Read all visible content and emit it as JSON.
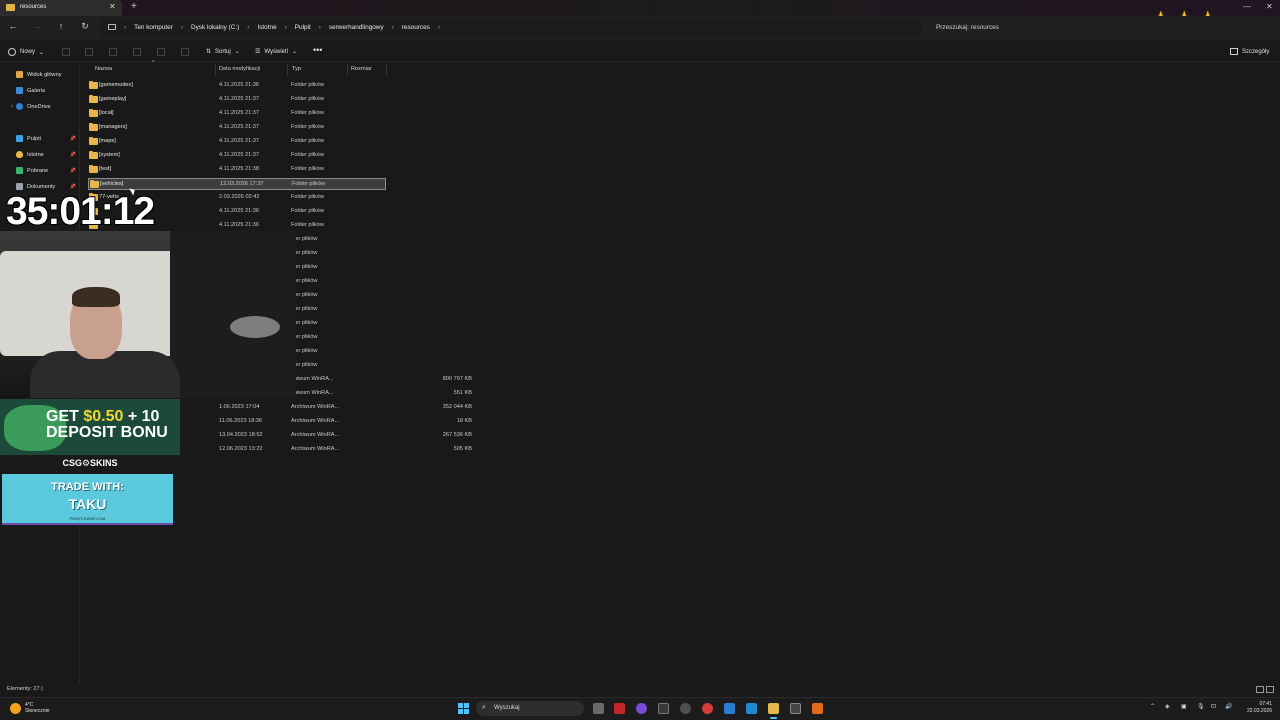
{
  "window": {
    "tab_title": "resources",
    "close_glyph": "✕",
    "new_tab_glyph": "+"
  },
  "nav": {
    "breadcrumbs": [
      "Ten komputer",
      "Dysk lokalny (C:)",
      "Istotne",
      "Pulpit",
      "serwerhandlingowy",
      "resources"
    ],
    "search_placeholder": "Przeszukaj: resources"
  },
  "commands": {
    "new_label": "Nowy",
    "sort_label": "Sortuj",
    "view_label": "Wyświetl",
    "more_label": "•••",
    "details_label": "Szczegóły"
  },
  "sidebar": {
    "items": [
      {
        "label": "Widok główny",
        "color": "#e0a84a"
      },
      {
        "label": "Galeria",
        "color": "#3b8ad8"
      },
      {
        "label": "OneDrive",
        "color": "#2f7fd6"
      },
      {
        "label": "Pulpit",
        "color": "#3aa0e8"
      },
      {
        "label": "Istotne",
        "color": "#e6b84a"
      },
      {
        "label": "Pobrane",
        "color": "#3bb56b"
      },
      {
        "label": "Dokumenty",
        "color": "#9aa3ad"
      }
    ]
  },
  "columns": {
    "name": "Nazwa",
    "date": "Data modyfikacji",
    "type": "Typ",
    "size": "Rozmiar"
  },
  "files": [
    {
      "name": "[gamemodes]",
      "date": "4.11.2025 21:36",
      "type": "Folder plików",
      "size": ""
    },
    {
      "name": "[gameplay]",
      "date": "4.11.2025 21:37",
      "type": "Folder plików",
      "size": ""
    },
    {
      "name": "[local]",
      "date": "4.11.2025 21:37",
      "type": "Folder plików",
      "size": ""
    },
    {
      "name": "[managers]",
      "date": "4.11.2025 21:37",
      "type": "Folder plików",
      "size": ""
    },
    {
      "name": "[maps]",
      "date": "4.11.2025 21:37",
      "type": "Folder plików",
      "size": ""
    },
    {
      "name": "[system]",
      "date": "4.11.2025 21:37",
      "type": "Folder plików",
      "size": ""
    },
    {
      "name": "[test]",
      "date": "4.11.2025 21:38",
      "type": "Folder plików",
      "size": ""
    },
    {
      "name": "[vehicles]",
      "date": "12.03.2026 17:37",
      "type": "Folder plików",
      "size": ""
    },
    {
      "name": "77-vehs",
      "date": "2.03.2026 02:42",
      "type": "Folder plików",
      "size": ""
    },
    {
      "name": "",
      "date": "4.11.2025 21:36",
      "type": "Folder plików",
      "size": ""
    },
    {
      "name": "",
      "date": "4.11.2025 21:36",
      "type": "Folder plików",
      "size": ""
    },
    {
      "name": "",
      "date": "",
      "type": "lder plików",
      "size": ""
    },
    {
      "name": "",
      "date": "",
      "type": "lder plików",
      "size": ""
    },
    {
      "name": "",
      "date": "",
      "type": "lder plików",
      "size": ""
    },
    {
      "name": "",
      "date": "",
      "type": "lder plików",
      "size": ""
    },
    {
      "name": "",
      "date": "",
      "type": "lder plików",
      "size": ""
    },
    {
      "name": "",
      "date": "",
      "type": "lder plików",
      "size": ""
    },
    {
      "name": "",
      "date": "",
      "type": "lder plików",
      "size": ""
    },
    {
      "name": "",
      "date": "",
      "type": "lder plików",
      "size": ""
    },
    {
      "name": "",
      "date": "",
      "type": "lder plików",
      "size": ""
    },
    {
      "name": "",
      "date": "",
      "type": "lder plików",
      "size": ""
    },
    {
      "name": "",
      "date": "",
      "type": "chiwum WinRA...",
      "size": "800 797 KB"
    },
    {
      "name": "",
      "date": "",
      "type": "chiwum WinRA...",
      "size": "551 KB"
    },
    {
      "name": "",
      "date": "1.06.2023 17:04",
      "type": "Archiwum WinRA...",
      "size": "352 044 KB"
    },
    {
      "name": "",
      "date": "11.06.2023 18:36",
      "type": "Archiwum WinRA...",
      "size": "18 KB"
    },
    {
      "name": "",
      "date": "13.04.2023 18:52",
      "type": "Archiwum WinRA...",
      "size": "267 536 KB"
    },
    {
      "name": "",
      "date": "12.06.2023 13:22",
      "type": "Archiwum WinRA...",
      "size": "505 KB"
    }
  ],
  "selected_index": 7,
  "overlay": {
    "timer": "35:01:12",
    "ad1_line1_a": "GET ",
    "ad1_line1_b": "$0.50",
    "ad1_line1_c": " + 10",
    "ad1_line2": "DEPOSIT BONU",
    "ad1_brand": "CSG⚙SKINS",
    "ad2_line1": "TRADE WITH:",
    "ad2_line2": "TAKU",
    "ad2_line3": "PIRATESWAP.COM"
  },
  "status": {
    "elements": "Elementy: 27  |"
  },
  "taskbar": {
    "temp": "4°C",
    "weather": "Słonecznie",
    "search": "Wyszukaj",
    "time": "07:41",
    "date": "22.03.2026"
  },
  "colors": {
    "accent": "#4cc2ff",
    "folder": "#e6b84a",
    "star": "#f4c21b"
  }
}
